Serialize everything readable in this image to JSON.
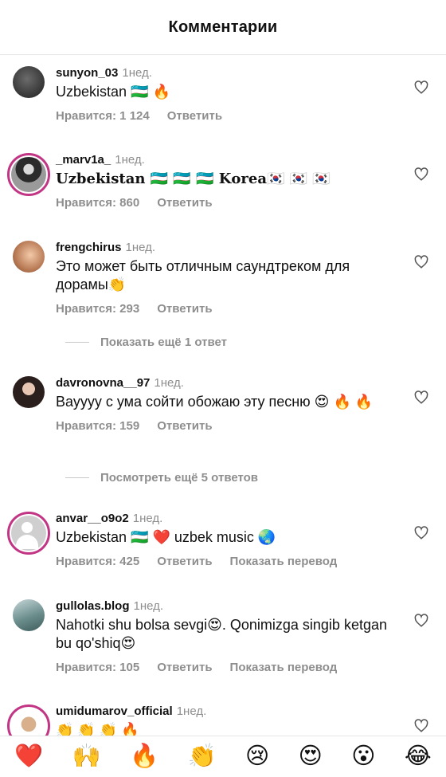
{
  "header": {
    "title": "Комментарии"
  },
  "comments": [
    {
      "username": "sunyon_03",
      "time": "1нед.",
      "text": "Uzbekistan 🇺🇿 🔥",
      "likes": "Нравится: 1 124",
      "reply": "Ответить",
      "translate": ""
    },
    {
      "username": "_marv1a_",
      "time": "1нед.",
      "text": "𝐔𝐳𝐛𝐞𝐤𝐢𝐬𝐭𝐚𝐧 🇺🇿 🇺🇿 🇺🇿 𝐊𝐨𝐫𝐞𝐚🇰🇷 🇰🇷 🇰🇷",
      "likes": "Нравится: 860",
      "reply": "Ответить",
      "translate": ""
    },
    {
      "username": "frengchirus",
      "time": "1нед.",
      "text": "Это может быть отличным саундтреком для дорамы👏",
      "likes": "Нравится: 293",
      "reply": "Ответить",
      "translate": ""
    },
    {
      "username": "davronovna__97",
      "time": "1нед.",
      "text": "Вауууу с ума сойти обожаю эту песню 😍 🔥 🔥",
      "likes": "Нравится: 159",
      "reply": "Ответить",
      "translate": ""
    },
    {
      "username": "anvar__o9o2",
      "time": "1нед.",
      "text": "Uzbekistan 🇺🇿 ❤️ uzbek music 🌏",
      "likes": "Нравится: 425",
      "reply": "Ответить",
      "translate": "Показать перевод"
    },
    {
      "username": "gullolas.blog",
      "time": "1нед.",
      "text": "Nahotki shu bolsa sevgi😍. Qonimizga singib ketgan bu qo'shiq😍",
      "likes": "Нравится: 105",
      "reply": "Ответить",
      "translate": "Показать перевод"
    },
    {
      "username": "umidumarov_official",
      "time": "1нед.",
      "text": "👏 👏 👏 🔥",
      "likes": "",
      "reply": "",
      "translate": ""
    }
  ],
  "more_replies": [
    "Показать ещё 1 ответ",
    "Посмотреть ещё 5 ответов"
  ],
  "reactions": [
    "❤️",
    "🙌",
    "🔥",
    "👏",
    "😢",
    "😍",
    "😮",
    "😂"
  ],
  "colors": {
    "story_ring": "#c13584",
    "secondary_text": "#8e8e8e"
  }
}
